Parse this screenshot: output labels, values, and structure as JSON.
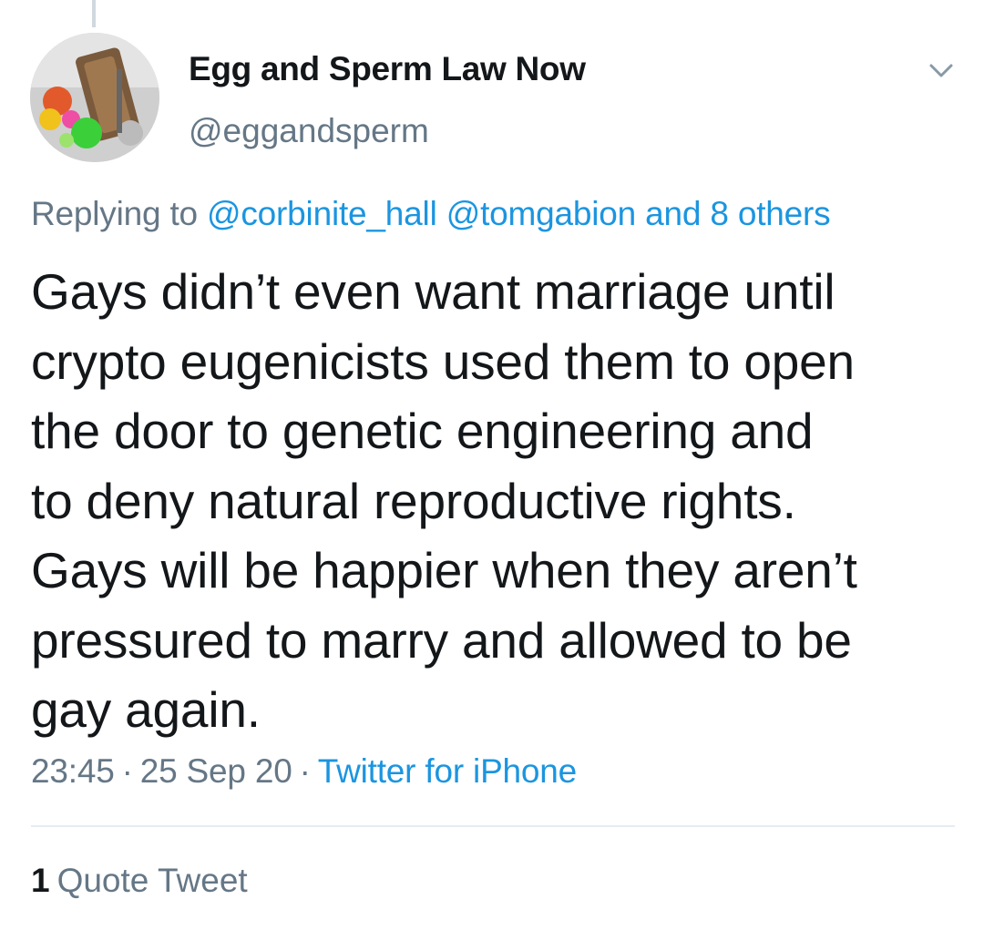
{
  "tweet": {
    "author": {
      "display_name": "Egg and Sperm Law Now",
      "handle": "@eggandsperm"
    },
    "reply": {
      "prefix": "Replying to",
      "mentions": [
        "@corbinite_hall",
        "@tomgabion"
      ],
      "others": "and 8 others"
    },
    "text_lines": [
      "Gays didn’t even want marriage until",
      "crypto eugenicists used them to open",
      "the door to genetic engineering and",
      "to deny natural reproductive rights.",
      "Gays will be happier when they aren’t",
      "pressured to marry and allowed to be",
      "gay again."
    ],
    "time": "23:45",
    "date": "25 Sep 20",
    "separator": "·",
    "source": "Twitter for iPhone",
    "stats": {
      "quote_count": "1",
      "quote_label": "Quote Tweet"
    }
  },
  "icons": {
    "caret": "chevron-down-icon"
  },
  "colors": {
    "link": "#1b95e0",
    "secondary_text": "#657786",
    "primary_text": "#14171a",
    "divider": "#e6ecf0"
  }
}
